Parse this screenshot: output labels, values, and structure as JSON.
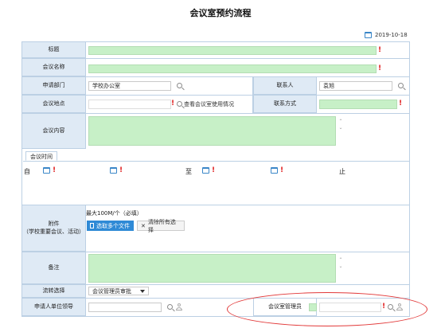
{
  "page": {
    "title": "会议室预约流程",
    "date": "2019-10-18"
  },
  "fields": {
    "subject_label": "标题",
    "meeting_name_label": "会议名称",
    "department_label": "申请部门",
    "department_value": "学校办公室",
    "contact_label": "联系人",
    "contact_value": "袁旭",
    "location_label": "会议地点",
    "room_usage_link": "查看会议室使用情况",
    "contact_method_label": "联系方式",
    "content_label": "会议内容",
    "attachment_label_line1": "附件",
    "attachment_label_line2": "（学校重要会议、活动）",
    "attachment_hint": "最大100M/个（必填）",
    "select_files_button": "选取多个文件",
    "clear_selection_button": "清除所有选择",
    "remarks_label": "备注",
    "flow_label": "流转选择",
    "flow_selected": "会议管理员审批",
    "leader_label": "申请人单位领导",
    "room_admin_label": "会议室管理员"
  },
  "time_section": {
    "tab_label": "会议时间",
    "from_label": "自",
    "to_label": "至",
    "end_label": "止"
  },
  "colors": {
    "label_bg": "#dfeaf5",
    "required_field": "#c7f0c7",
    "accent_blue": "#2f8ad6",
    "required_mark": "#e02020",
    "annotation_red": "#e23a3a"
  }
}
